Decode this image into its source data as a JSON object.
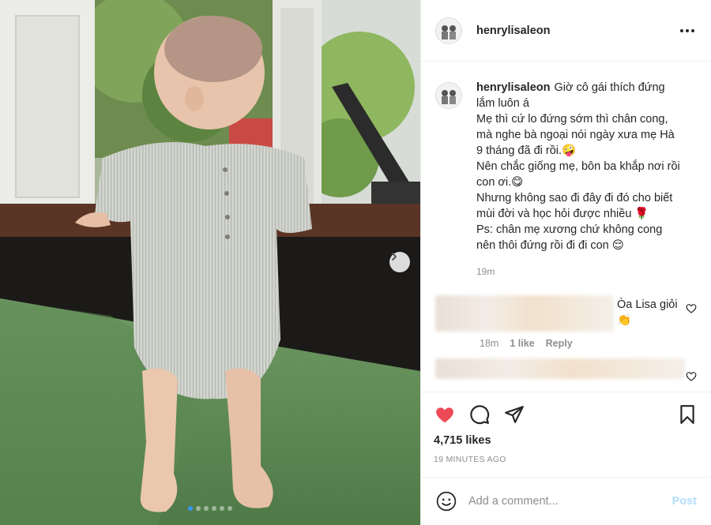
{
  "post": {
    "username": "henrylisaleon",
    "caption": {
      "username": "henrylisaleon",
      "lines": [
        "Giờ cô gái thích đứng",
        "lắm luôn á",
        "Mẹ thì cứ lo đứng sớm thì chân cong,",
        "mà nghe bà ngoại nói ngày xưa mẹ Hà",
        "9 tháng đã đi rồi.🤪",
        "Nên chắc giống mẹ, bôn ba khắp nơi rồi",
        "con ơi.😋",
        "Nhưng không sao đi đây đi đó cho biết",
        "mùi đời và học hỏi được nhiều 🌹",
        "Ps: chân mẹ xương chứ không cong",
        "nên thôi đứng rồi đi đi con 😌"
      ],
      "time": "19m"
    },
    "comments": [
      {
        "text_line1": "Òa Lisa giỏi",
        "text_line2": "👏",
        "time": "18m",
        "likes": "1 like",
        "reply": "Reply"
      }
    ],
    "likes": "4,715 likes",
    "posted_ago": "19 MINUTES AGO",
    "add_comment_placeholder": "Add a comment...",
    "post_label": "Post"
  },
  "carousel": {
    "slide_count": 6,
    "active_index": 0
  },
  "colors": {
    "heart": "#ed4956",
    "link_disabled": "#b2dffc",
    "dot_active": "#3897f0",
    "muted": "#8e8e8e"
  },
  "icons": [
    "more-icon",
    "heart-icon",
    "comment-icon",
    "share-icon",
    "bookmark-icon",
    "emoji-icon",
    "chevron-right-icon"
  ]
}
